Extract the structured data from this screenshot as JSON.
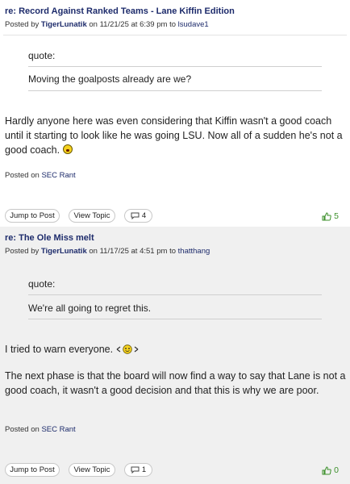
{
  "posts": [
    {
      "title": "re: Record Against Ranked Teams - Lane Kiffin Edition",
      "posted_by_label": "Posted by",
      "author": "TigerLunatik",
      "on_label": "on",
      "date": "11/21/25",
      "at_label": "at",
      "time": "6:39 pm",
      "to_label": "to",
      "reply_to": "lsudave1",
      "quote_label": "quote:",
      "quote_text": "Moving the goalposts already are we?",
      "body": [
        "Hardly anyone here was even considering that Kiffin wasn't a good coach until it starting to look like he was going LSU. Now all of a sudden he's not a good coach."
      ],
      "emoji": "yelling-face",
      "posted_on_label": "Posted on",
      "board": "SEC Rant",
      "jump_label": "Jump to Post",
      "view_label": "View Topic",
      "reply_count": "4",
      "upvotes": "5"
    },
    {
      "title": "re: The Ole Miss melt",
      "posted_by_label": "Posted by",
      "author": "TigerLunatik",
      "on_label": "on",
      "date": "11/17/25",
      "at_label": "at",
      "time": "4:51 pm",
      "to_label": "to",
      "reply_to": "thatthang",
      "quote_label": "quote:",
      "quote_text": "We're all going to regret this.",
      "body": [
        "I tried to warn everyone.",
        "The next phase is that the board will now find a way to say that Lane is not a good coach, it wasn't a good decision and that this is why we are poor."
      ],
      "emoji": "waving-smiley",
      "posted_on_label": "Posted on",
      "board": "SEC Rant",
      "jump_label": "Jump to Post",
      "view_label": "View Topic",
      "reply_count": "1",
      "upvotes": "0"
    }
  ],
  "colors": {
    "link": "#1d2b6b",
    "upvote_green": "#3b8f2a",
    "alt_background": "#f0f0f0"
  },
  "icons": [
    "speech-bubble-icon",
    "thumbs-up-icon",
    "yelling-face-emoji",
    "waving-smiley-emoji"
  ]
}
